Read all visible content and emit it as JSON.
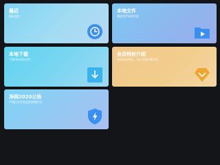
{
  "colors": {
    "background": "#141518",
    "icon_blue": "#3a8ff0",
    "icon_orange": "#f0a52e",
    "icon_glyph": "#ffffff"
  },
  "cards": [
    {
      "title": "最近",
      "subtitle": "精彩回忆",
      "icon": "clock-icon"
    },
    {
      "title": "本地文件",
      "subtitle": "播放我手机的内容",
      "icon": "video-folder-icon"
    },
    {
      "title": "本地下载",
      "subtitle": "下载Http/ftp文件",
      "icon": "download-icon"
    },
    {
      "title": "会员特权介绍",
      "subtitle": "极速会员特权，可以无遮挡看评论",
      "icon": "vip-gem-icon"
    },
    {
      "title": "净网2020公告",
      "subtitle": "严格打击不良信息传播行为",
      "icon": "shield-bolt-icon"
    }
  ]
}
